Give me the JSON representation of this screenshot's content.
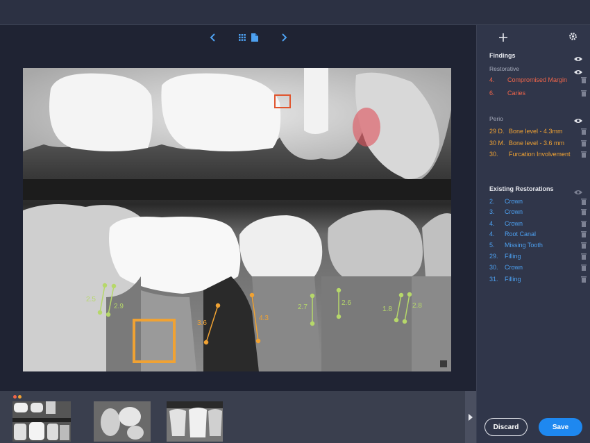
{
  "viewer": {
    "nav": {
      "prev_icon": "chevron-left-icon",
      "grid_icon": "grid-icon",
      "doc_icon": "document-icon",
      "next_icon": "chevron-right-icon"
    },
    "measurements": [
      {
        "label": "2.5",
        "color": "#b6d86a"
      },
      {
        "label": "2.9",
        "color": "#b6d86a"
      },
      {
        "label": "3.6",
        "color": "#f0a233"
      },
      {
        "label": "4.3",
        "color": "#f0a233"
      },
      {
        "label": "2.7",
        "color": "#b6d86a"
      },
      {
        "label": "2.6",
        "color": "#b6d86a"
      },
      {
        "label": "1.8",
        "color": "#b6d86a"
      },
      {
        "label": "2.8",
        "color": "#b6d86a"
      }
    ]
  },
  "sidebar": {
    "add_icon": "plus-icon",
    "settings_icon": "gear-icon",
    "findings": {
      "title": "Findings",
      "restorative": {
        "title": "Restorative",
        "color": "#f0654a",
        "items": [
          {
            "num": "4.",
            "label": "Compromised Margin"
          },
          {
            "num": "6.",
            "label": "Caries"
          }
        ]
      },
      "perio": {
        "title": "Perio",
        "color": "#f0a233",
        "items": [
          {
            "num": "29 D.",
            "label": "Bone level - 4.3mm"
          },
          {
            "num": "30 M.",
            "label": "Bone level - 3.6 mm"
          },
          {
            "num": "30.",
            "label": "Furcation Involvement"
          }
        ]
      }
    },
    "existing": {
      "title": "Existing Restorations",
      "color": "#4da0f0",
      "items": [
        {
          "num": "2.",
          "label": "Crown"
        },
        {
          "num": "3.",
          "label": "Crown"
        },
        {
          "num": "4.",
          "label": "Crown"
        },
        {
          "num": "4.",
          "label": "Root Canal"
        },
        {
          "num": "5.",
          "label": "Missing Tooth"
        },
        {
          "num": "29.",
          "label": "Filling"
        },
        {
          "num": "30.",
          "label": "Crown"
        },
        {
          "num": "31.",
          "label": "Filling"
        }
      ]
    },
    "buttons": {
      "discard": "Discard",
      "save": "Save"
    }
  },
  "thumbnails": {
    "next_icon": "chevron-right-icon",
    "status_dot_colors": [
      "#f0654a",
      "#f0a233"
    ]
  }
}
